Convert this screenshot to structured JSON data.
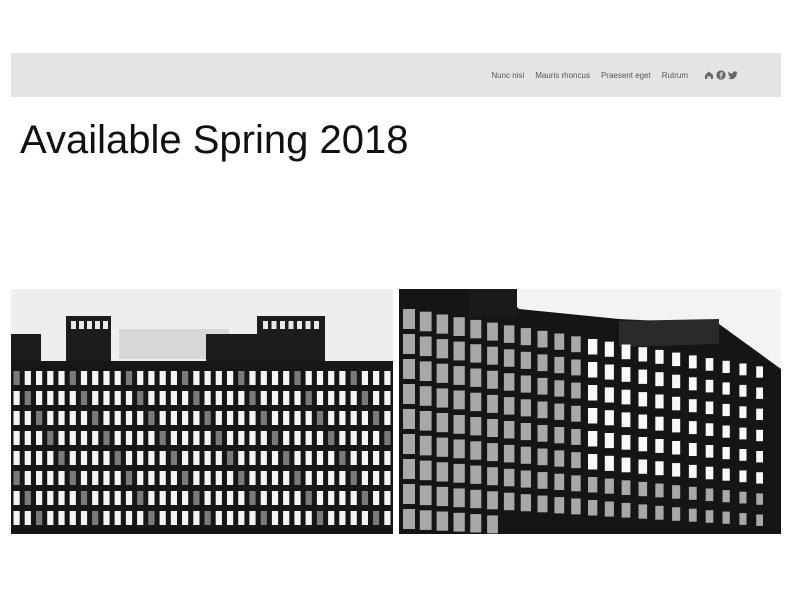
{
  "nav": {
    "links": [
      {
        "label": "Nunc nisi"
      },
      {
        "label": "Mauris rhoncus"
      },
      {
        "label": "Praesent eget"
      },
      {
        "label": "Rutrum"
      }
    ],
    "social_icons": [
      "houzz-icon",
      "facebook-icon",
      "twitter-icon"
    ]
  },
  "headline": "Available Spring 2018",
  "photos": [
    {
      "name": "building-photo-left",
      "subject": "black-and-white office building facade, frontal view"
    },
    {
      "name": "building-photo-right",
      "subject": "black-and-white office building facade, angled view"
    }
  ],
  "colors": {
    "navbar_bg": "#e4e4e4",
    "nav_text": "#555555",
    "headline_text": "#111111",
    "page_bg": "#ffffff"
  }
}
